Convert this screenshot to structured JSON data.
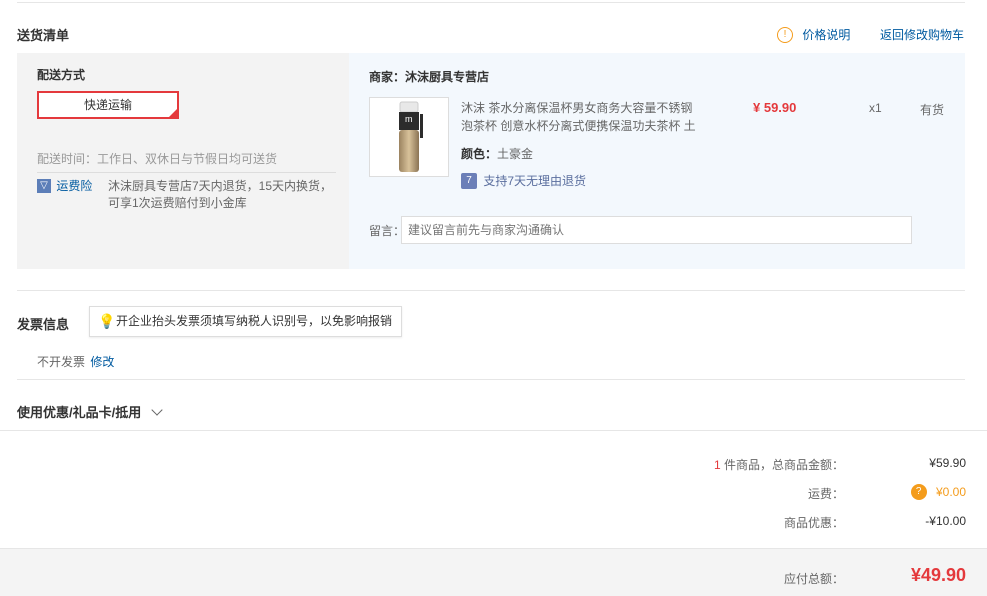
{
  "section_title": "送货清单",
  "price_note": "价格说明",
  "back_link": "返回修改购物车",
  "shipping": {
    "title": "配送方式",
    "method": "快递运输",
    "time_label": "配送时间：",
    "time_value": "工作日、双休日与节假日均可送货",
    "insurance_label": "运费险",
    "insurance_desc_1": "沐沫厨具专营店7天内退货，15天内换货，",
    "insurance_desc_2": "可享1次运费赔付到小金库"
  },
  "vendor": {
    "label": "商家：沐沫厨具专营店",
    "product": {
      "name_1": "沐沫 茶水分离保温杯男女商务大容量不锈钢",
      "name_2": "泡茶杯 创意水杯分离式便携保温功夫茶杯 土",
      "price": "¥ 59.90",
      "qty": "x1",
      "stock": "有货",
      "color_label": "颜色：",
      "color_value": "土豪金",
      "return_policy": "支持7天无理由退货",
      "logo_letter": "m"
    },
    "note_label": "留言：",
    "note_placeholder": "建议留言前先与商家沟通确认"
  },
  "invoice": {
    "title": "发票信息",
    "tip": "开企业抬头发票须填写纳税人识别号，以免影响报销",
    "status": "不开发票",
    "edit": "修改"
  },
  "discount": {
    "title": "使用优惠/礼品卡/抵用"
  },
  "summary": {
    "count": "1",
    "count_suffix": "件商品，总商品金额：",
    "goods_total": "¥59.90",
    "shipping_label": "运费：",
    "shipping_value": "¥0.00",
    "discount_label": "商品优惠：",
    "discount_value": "-¥10.00",
    "payable_label": "应付总额：",
    "payable_value": "¥49.90"
  },
  "colors": {
    "accent_red": "#e4393c",
    "link_blue": "#005aa0",
    "shipping_orange": "#f49c1c"
  }
}
